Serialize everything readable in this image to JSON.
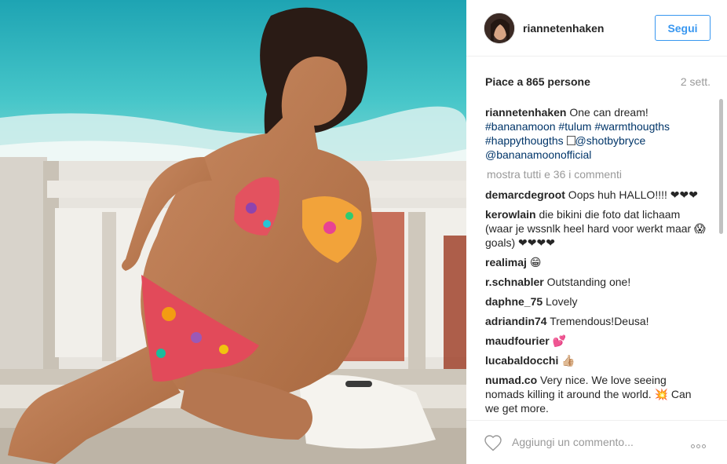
{
  "post": {
    "username": "riannetenhaken",
    "follow_label": "Segui",
    "likes_text": "Piace a 865 persone",
    "age_text": "2 sett."
  },
  "caption": {
    "author": "riannetenhaken",
    "text": " One can dream!",
    "tags_line1": "#bananamoon #tulum #warmthougths",
    "tags_line2_a": "#happythougths",
    "tags_line2_b": "@shotbybryce",
    "tags_line3": "@bananamoonofficial"
  },
  "more_comments": "mostra tutti e 36 i commenti",
  "comments": [
    {
      "author": "demarcdegroot",
      "text": " Oops huh HALLO!!!! ❤❤❤"
    },
    {
      "author": "kerowlain",
      "text": " die bikini die foto dat lichaam (waar je wssnlk heel hard voor werkt maar 😱goals) ❤❤❤❤"
    },
    {
      "author": "realimaj",
      "text": " 😁"
    },
    {
      "author": "r.schnabler",
      "text": " Outstanding one!"
    },
    {
      "author": "daphne_75",
      "text": " Lovely"
    },
    {
      "author": "adriandin74",
      "text": " Tremendous!Deusa!"
    },
    {
      "author": "maudfourier",
      "text": " 💕"
    },
    {
      "author": "lucabaldocchi",
      "text": " 👍🏼"
    },
    {
      "author": "numad.co",
      "text": " Very nice. We love seeing nomads killing it around the world. 💥 Can we get more."
    }
  ],
  "footer": {
    "comment_placeholder": "Aggiungi un commento..."
  },
  "icons": {
    "like": "heart-icon",
    "options": "more-options-icon"
  },
  "colors": {
    "link_blue": "#3897f0",
    "hashtag": "#003569",
    "muted": "#999999"
  }
}
